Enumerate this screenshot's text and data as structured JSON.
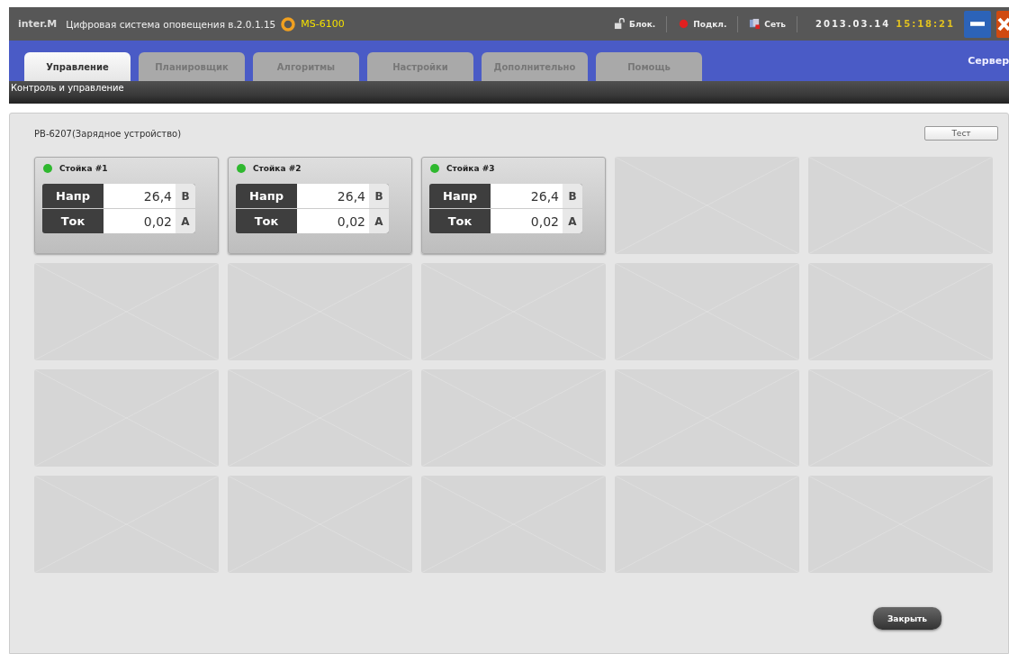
{
  "window": {
    "logo": "inter.M",
    "title": "Цифровая система оповещения в.2.0.1.15",
    "model": "MS-6100"
  },
  "status": [
    {
      "kind": "lock",
      "label": "Блок."
    },
    {
      "kind": "dot",
      "label": "Подкл.",
      "color": "#e02020"
    },
    {
      "kind": "network",
      "label": "Сеть"
    }
  ],
  "date": "2013.03.14",
  "time": "15:18:21",
  "tabs": [
    {
      "label": "Управление",
      "selected": true
    },
    {
      "label": "Планировщик",
      "selected": false
    },
    {
      "label": "Алгоритмы",
      "selected": false
    },
    {
      "label": "Настройки",
      "selected": false
    },
    {
      "label": "Дополнительно",
      "selected": false
    },
    {
      "label": "Помощь",
      "selected": false
    }
  ],
  "server_label": "Сервер",
  "subtitle": "Контроль и управление",
  "panel": {
    "title": "PB-6207(Зарядное устройство)",
    "test_button": "Тест",
    "close_button": "Закрыть"
  },
  "slots": [
    {
      "kind": "rack",
      "name": "Стойка #1",
      "color": "#2fb82f",
      "rows": [
        {
          "label": "Напр",
          "value": "26,4",
          "unit": "В"
        },
        {
          "label": "Ток",
          "value": "0,02",
          "unit": "А"
        }
      ]
    },
    {
      "kind": "rack",
      "name": "Стойка #2",
      "color": "#2fb82f",
      "rows": [
        {
          "label": "Напр",
          "value": "26,4",
          "unit": "В"
        },
        {
          "label": "Ток",
          "value": "0,02",
          "unit": "А"
        }
      ]
    },
    {
      "kind": "rack",
      "name": "Стойка #3",
      "color": "#2fb82f",
      "rows": [
        {
          "label": "Напр",
          "value": "26,4",
          "unit": "В"
        },
        {
          "label": "Ток",
          "value": "0,02",
          "unit": "А"
        }
      ]
    },
    {
      "kind": "empty"
    },
    {
      "kind": "empty"
    },
    {
      "kind": "empty"
    },
    {
      "kind": "empty"
    },
    {
      "kind": "empty"
    },
    {
      "kind": "empty"
    },
    {
      "kind": "empty"
    },
    {
      "kind": "empty"
    },
    {
      "kind": "empty"
    },
    {
      "kind": "empty"
    },
    {
      "kind": "empty"
    },
    {
      "kind": "empty"
    },
    {
      "kind": "empty"
    },
    {
      "kind": "empty"
    },
    {
      "kind": "empty"
    },
    {
      "kind": "empty"
    },
    {
      "kind": "empty"
    }
  ]
}
